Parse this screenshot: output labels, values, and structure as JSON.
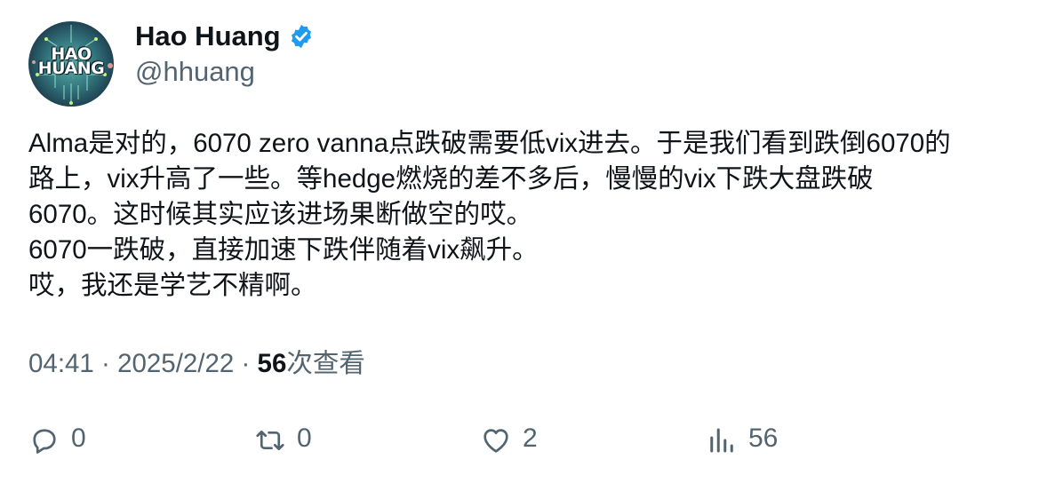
{
  "author": {
    "avatar_text_line1": "HAO",
    "avatar_text_line2": "HUANG",
    "display_name": "Hao Huang",
    "handle": "@hhuang",
    "verified_icon": "verified-badge-icon",
    "verified_color": "#1d9bf0"
  },
  "tweet": {
    "lines": [
      "Alma是对的，6070 zero vanna点跌破需要低vix进去。于是我们看到跌倒6070的",
      "路上，vix升高了一些。等hedge燃烧的差不多后，慢慢的vix下跌大盘跌破",
      "6070。这时候其实应该进场果断做空的哎。",
      "6070一跌破，直接加速下跌伴随着vix飙升。",
      "哎，我还是学艺不精啊。"
    ]
  },
  "meta": {
    "time": "04:41",
    "separator": "·",
    "date": "2025/2/22",
    "views_count": "56",
    "views_label": "次查看"
  },
  "actions": {
    "reply": {
      "icon": "reply-icon",
      "count": "0"
    },
    "retweet": {
      "icon": "retweet-icon",
      "count": "0"
    },
    "like": {
      "icon": "heart-icon",
      "count": "2"
    },
    "views": {
      "icon": "views-chart-icon",
      "count": "56"
    }
  },
  "colors": {
    "text_primary": "#0f1419",
    "text_secondary": "#536471",
    "accent": "#1d9bf0"
  }
}
